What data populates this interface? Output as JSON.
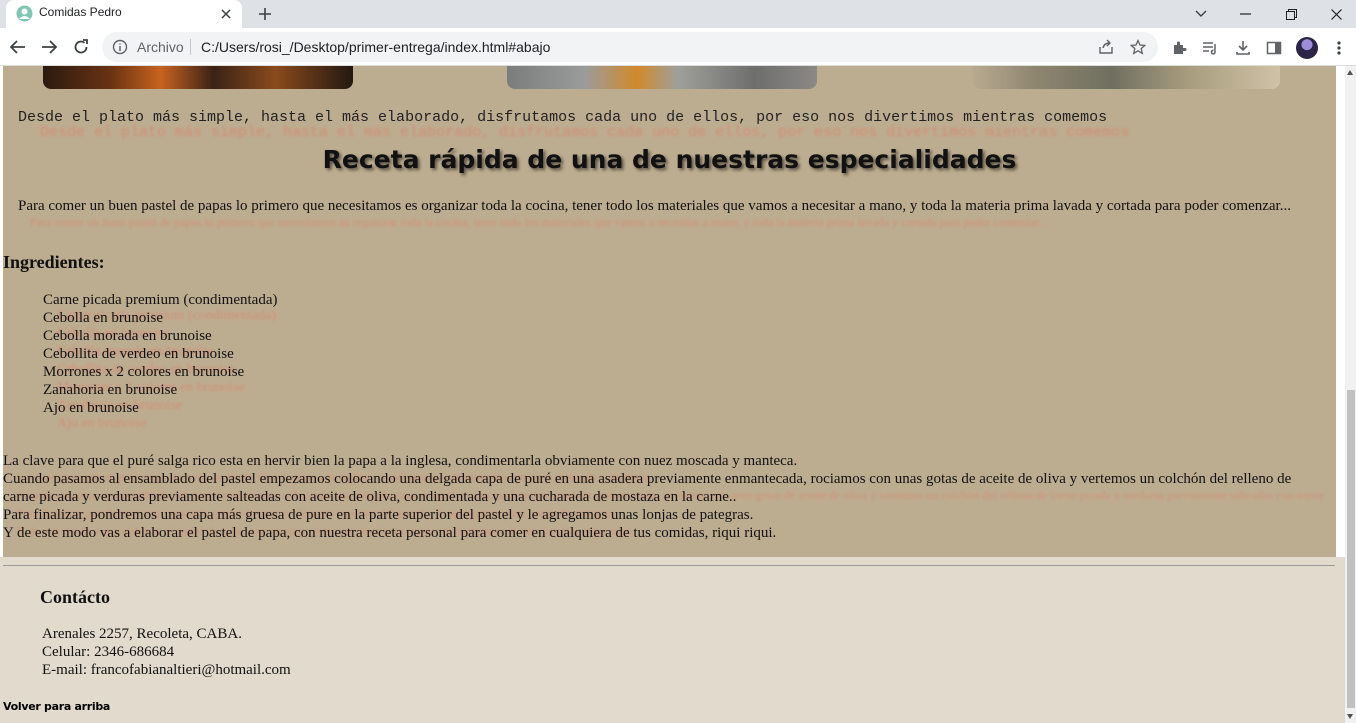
{
  "browser": {
    "tab_title": "Comidas Pedro",
    "address_prefix": "Archivo",
    "url": "C:/Users/rosi_/Desktop/primer-entrega/index.html#abajo",
    "icons": [
      "back-arrow-icon",
      "forward-arrow-icon",
      "reload-icon",
      "info-icon",
      "share-icon",
      "star-icon",
      "extensions-icon",
      "reading-list-icon",
      "download-icon",
      "side-panel-icon",
      "profile-avatar",
      "menu-icon"
    ]
  },
  "page": {
    "tagline": "Desde el plato más simple, hasta el más elaborado, disfrutamos cada uno de ellos, por eso nos divertimos mientras comemos",
    "recipe_title": "Receta rápida de una de nuestras especialidades",
    "intro": "Para comer un buen pastel de papas lo primero que necesitamos es organizar toda la cocina, tener todo los materiales que vamos a necesitar a mano, y toda la materia prima lavada y cortada para poder comenzar...",
    "ingredients_heading": "Ingredientes:",
    "ingredients": [
      "Carne picada premium (condimentada)",
      "Cebolla en brunoise",
      "Cebolla morada en brunoise",
      "Cebollita de verdeo en brunoise",
      "Morrones x 2 colores en brunoise",
      "Zanahoria en brunoise",
      "Ajo en brunoise"
    ],
    "steps": [
      "La clave para que el puré salga rico esta en hervir bien la papa a la inglesa, condimentarla obviamente con nuez moscada y manteca.",
      "Cuando pasamos al ensamblado del pastel empezamos colocando una delgada capa de puré en una asadera previamente enmantecada, rociamos con unas gotas de aceite de oliva y vertemos un colchón del relleno de carne picada y verduras previamente salteadas con aceite de oliva, condimentada y una cucharada de mostaza en la carne..",
      "Para finalizar, pondremos una capa más gruesa de pure en la parte superior del pastel y le agregamos unas lonjas de pategras.",
      "Y de este modo vas a elaborar el pastel de papa, con nuestra receta personal para comer en cualquiera de tus comidas, riqui riqui."
    ]
  },
  "footer": {
    "contact_heading": "Contácto",
    "address": "Arenales 2257, Recoleta, CABA.",
    "phone": "Celular: 2346-686684",
    "email": "E-mail: francofabianaltieri@hotmail.com",
    "back_to_top": "Volver para arriba"
  },
  "colors": {
    "content_bg": "#bdad90",
    "footer_bg": "#e2dacd",
    "text_shadow_red": "#e26f62"
  }
}
